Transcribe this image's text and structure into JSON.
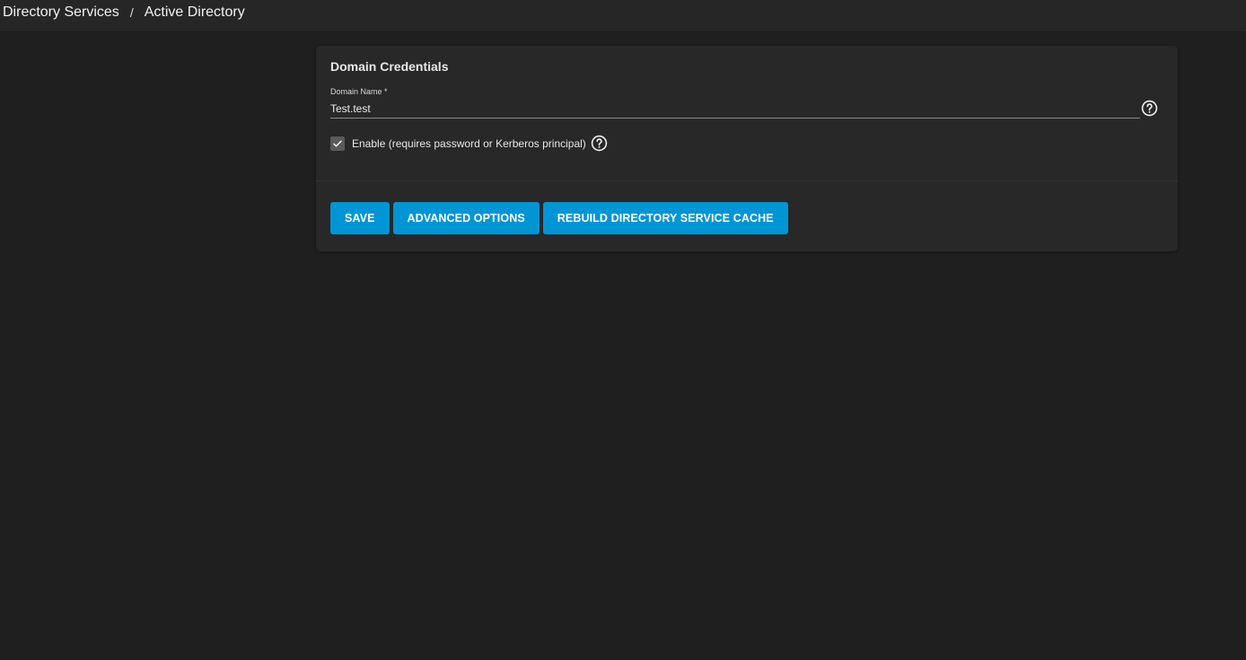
{
  "breadcrumb": {
    "items": [
      "Directory Services",
      "Active Directory"
    ],
    "separator": "/"
  },
  "card": {
    "title": "Domain Credentials",
    "domain_name": {
      "label": "Domain Name *",
      "value": "Test.test",
      "help_icon": "help-circle-icon"
    },
    "enable": {
      "label": "Enable (requires password or Kerberos principal)",
      "checked": true,
      "help_icon": "help-circle-icon"
    },
    "buttons": {
      "save": "SAVE",
      "advanced": "ADVANCED OPTIONS",
      "rebuild": "REBUILD DIRECTORY SERVICE CACHE"
    }
  },
  "colors": {
    "background": "#1f1f1f",
    "topbar": "#262626",
    "card": "#282828",
    "accent": "#0095d5"
  }
}
